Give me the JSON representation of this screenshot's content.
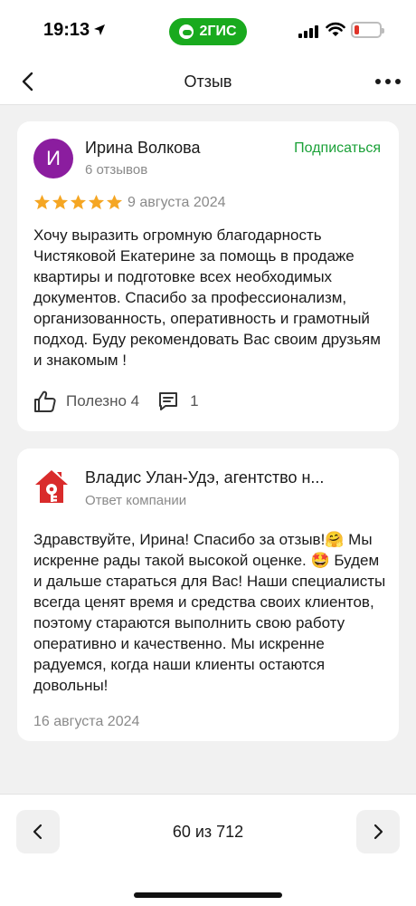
{
  "status_bar": {
    "time": "19:13",
    "brand": "2ГИС"
  },
  "nav": {
    "title": "Отзыв"
  },
  "review": {
    "author_initial": "И",
    "author_name": "Ирина Волкова",
    "author_meta": "6 отзывов",
    "subscribe_label": "Подписаться",
    "rating": 5,
    "date": "9 августа 2024",
    "text": "Хочу выразить огромную благодарность Чистяковой Екатерине за помощь в продаже квартиры и подготовке всех необходимых документов. Спасибо за профессионализм, организованность, оперативность и грамотный подход. Буду рекомендовать Вас своим друзьям и знакомым !",
    "helpful_label": "Полезно 4",
    "comments_count": "1"
  },
  "reply": {
    "company_name": "Владис Улан-Удэ, агентство н...",
    "company_meta": "Ответ компании",
    "text": "Здравствуйте, Ирина! Спасибо за отзыв!🤗 Мы искренне рады такой высокой оценке. 🤩 Будем и дальше стараться для Вас! Наши специалисты всегда ценят время и средства своих клиентов, поэтому стараются выполнить свою работу оперативно и качественно. Мы искренне радуемся, когда наши клиенты остаются довольны!",
    "date": "16 августа 2024"
  },
  "pager": {
    "label": "60 из 712"
  },
  "colors": {
    "accent_green": "#1ba138",
    "brand_green": "#19aa1e",
    "star": "#f5a623",
    "avatar": "#8b1d9f",
    "logo_red": "#d92b2b"
  }
}
